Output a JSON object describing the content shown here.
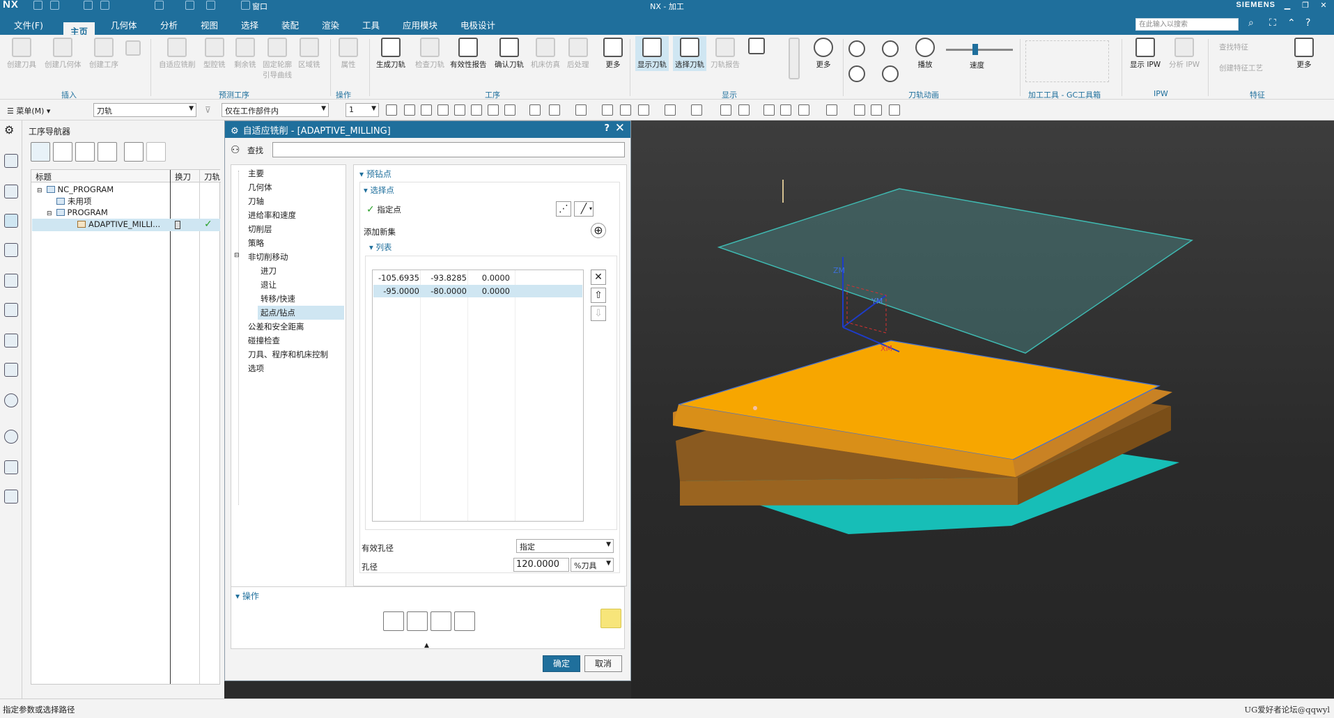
{
  "app": {
    "logo": "NX",
    "title": "NX - 加工",
    "brand": "SIEMENS",
    "window_menu": "窗口",
    "accent_color": "#1f6f9c",
    "model_color": "#f7a600"
  },
  "menu": {
    "items": [
      "文件(F)",
      "主页",
      "几何体",
      "分析",
      "视图",
      "选择",
      "装配",
      "渲染",
      "工具",
      "应用模块",
      "电极设计"
    ],
    "active": "主页",
    "search_placeholder": "在此输入以搜索"
  },
  "ribbon": {
    "insert": [
      "创建刀具",
      "创建几何体",
      "创建工序"
    ],
    "predefined": [
      "自适应铣削",
      "型腔铣",
      "剩余铣",
      "固定轮廓引导曲线",
      "区域铣"
    ],
    "operation": [
      "属性"
    ],
    "process": [
      "生成刀轨",
      "检查刀轨",
      "有效性报告",
      "确认刀轨",
      "机床仿真",
      "后处理",
      "更多"
    ],
    "display": [
      "显示刀轨",
      "选择刀轨",
      "刀轨报告",
      "更多"
    ],
    "animation": [
      "播放",
      "速度"
    ],
    "ipw": [
      "显示 IPW",
      "分析 IPW"
    ],
    "features": [
      "查找特征",
      "创建特征工艺",
      "更多"
    ],
    "groups": [
      "插入",
      "预测工序",
      "操作",
      "工序",
      "显示",
      "刀轨动画",
      "加工工具 - GC工具箱",
      "IPW",
      "特征"
    ]
  },
  "toolbar2": {
    "menu_label": "菜单(M)",
    "filter_value": "刀轨",
    "scope_value": "仅在工作部件内",
    "level_value": "1"
  },
  "navigator": {
    "title": "工序导航器",
    "columns": [
      "标题",
      "换刀",
      "刀轨"
    ],
    "nodes": [
      "NC_PROGRAM",
      "未用项",
      "PROGRAM",
      "ADAPTIVE_MILLI..."
    ]
  },
  "dialog": {
    "title": "自适应铣削 - [ADAPTIVE_MILLING]",
    "help": "?",
    "close": "✕",
    "find_label": "查找",
    "find_value": "",
    "tree": [
      "主要",
      "几何体",
      "刀轴",
      "进给率和速度",
      "切削层",
      "策略",
      "非切削移动",
      "进刀",
      "退让",
      "转移/快速",
      "起点/钻点",
      "公差和安全距离",
      "碰撞检查",
      "刀具、程序和机床控制",
      "选项"
    ],
    "tree_selected": "起点/钻点",
    "section_predrill": "预钻点",
    "section_select": "选择点",
    "specify_point": "指定点",
    "add_new_set": "添加新集",
    "section_list": "列表",
    "list_rows": [
      [
        "-105.6935",
        "-93.8285",
        "0.0000"
      ],
      [
        "-95.0000",
        "-80.0000",
        "0.0000"
      ]
    ],
    "effective_diameter_label": "有效孔径",
    "effective_diameter_value": "指定",
    "diameter_label": "孔径",
    "diameter_value": "120.0000",
    "diameter_unit": "%刀具",
    "section_operation": "操作",
    "ok": "确定",
    "cancel": "取消"
  },
  "viewport": {
    "labels": [
      "ZM",
      "YM",
      "XM"
    ]
  },
  "status": {
    "message": "指定参数或选择路径",
    "watermark": "UG爱好者论坛@qqwyl"
  }
}
